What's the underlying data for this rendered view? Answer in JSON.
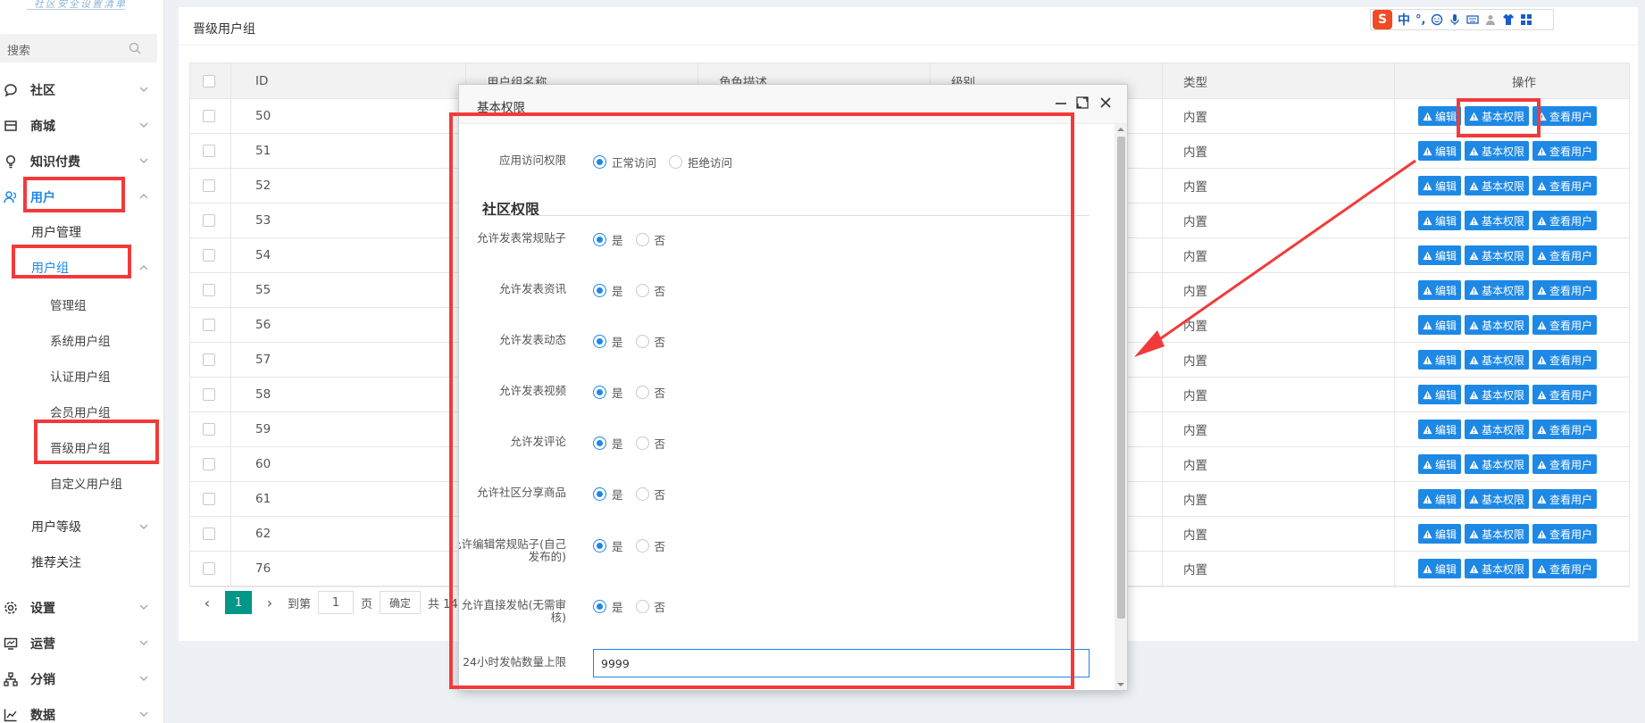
{
  "sidebar": {
    "logo_text": "社区安全设置清单",
    "search_placeholder": "搜索",
    "nav": [
      {
        "label": "社区",
        "icon": "chat-icon"
      },
      {
        "label": "商城",
        "icon": "shop-icon"
      },
      {
        "label": "知识付费",
        "icon": "lightbulb-icon"
      },
      {
        "label": "用户",
        "icon": "users-icon"
      },
      {
        "label": "设置",
        "icon": "gear-icon"
      },
      {
        "label": "运营",
        "icon": "monitor-icon"
      },
      {
        "label": "分销",
        "icon": "network-icon"
      },
      {
        "label": "数据",
        "icon": "chart-icon"
      }
    ],
    "user_sub": {
      "manage": "用户管理",
      "group": "用户组",
      "group_items": [
        "管理组",
        "系统用户组",
        "认证用户组",
        "会员用户组",
        "晋级用户组",
        "自定义用户组"
      ],
      "level": "用户等级",
      "recommend": "推荐关注"
    }
  },
  "page": {
    "title": "晋级用户组"
  },
  "table": {
    "headers": {
      "id": "ID",
      "name": "用户组名称",
      "desc": "角色描述",
      "level": "级别",
      "type": "类型",
      "ops": "操作"
    },
    "rows": [
      {
        "id": "50",
        "type": "内置"
      },
      {
        "id": "51",
        "type": "内置"
      },
      {
        "id": "52",
        "type": "内置"
      },
      {
        "id": "53",
        "type": "内置"
      },
      {
        "id": "54",
        "type": "内置"
      },
      {
        "id": "55",
        "type": "内置"
      },
      {
        "id": "56",
        "type": "内置"
      },
      {
        "id": "57",
        "type": "内置"
      },
      {
        "id": "58",
        "type": "内置"
      },
      {
        "id": "59",
        "type": "内置"
      },
      {
        "id": "60",
        "type": "内置"
      },
      {
        "id": "61",
        "type": "内置"
      },
      {
        "id": "62",
        "type": "内置"
      },
      {
        "id": "76",
        "type": "内置"
      }
    ],
    "buttons": {
      "edit": "编辑",
      "perm": "基本权限",
      "users": "查看用户"
    }
  },
  "pager": {
    "prev": "‹",
    "current": "1",
    "next": "›",
    "goto": "到第",
    "input": "1",
    "page": "页",
    "confirm": "确定",
    "total": "共 14"
  },
  "ime": {
    "logo": "S",
    "lang": "中",
    "punct": "°,"
  },
  "modal": {
    "title": "基本权限",
    "access_label": "应用访问权限",
    "access_opt1": "正常访问",
    "access_opt2": "拒绝访问",
    "section": "社区权限",
    "yes": "是",
    "no": "否",
    "perms": [
      "允许发表常规贴子",
      "允许发表资讯",
      "允许发表动态",
      "允许发表视频",
      "允许发评论",
      "允许社区分享商品",
      "允许编辑常规贴子(自己发布的)",
      "允许直接发帖(无需审核)"
    ],
    "limit_label": "24小时发帖数量上限",
    "limit_value": "9999"
  },
  "colors": {
    "accent": "#1e88e5",
    "highlight": "#f23a3a",
    "pager_active": "#009688"
  }
}
